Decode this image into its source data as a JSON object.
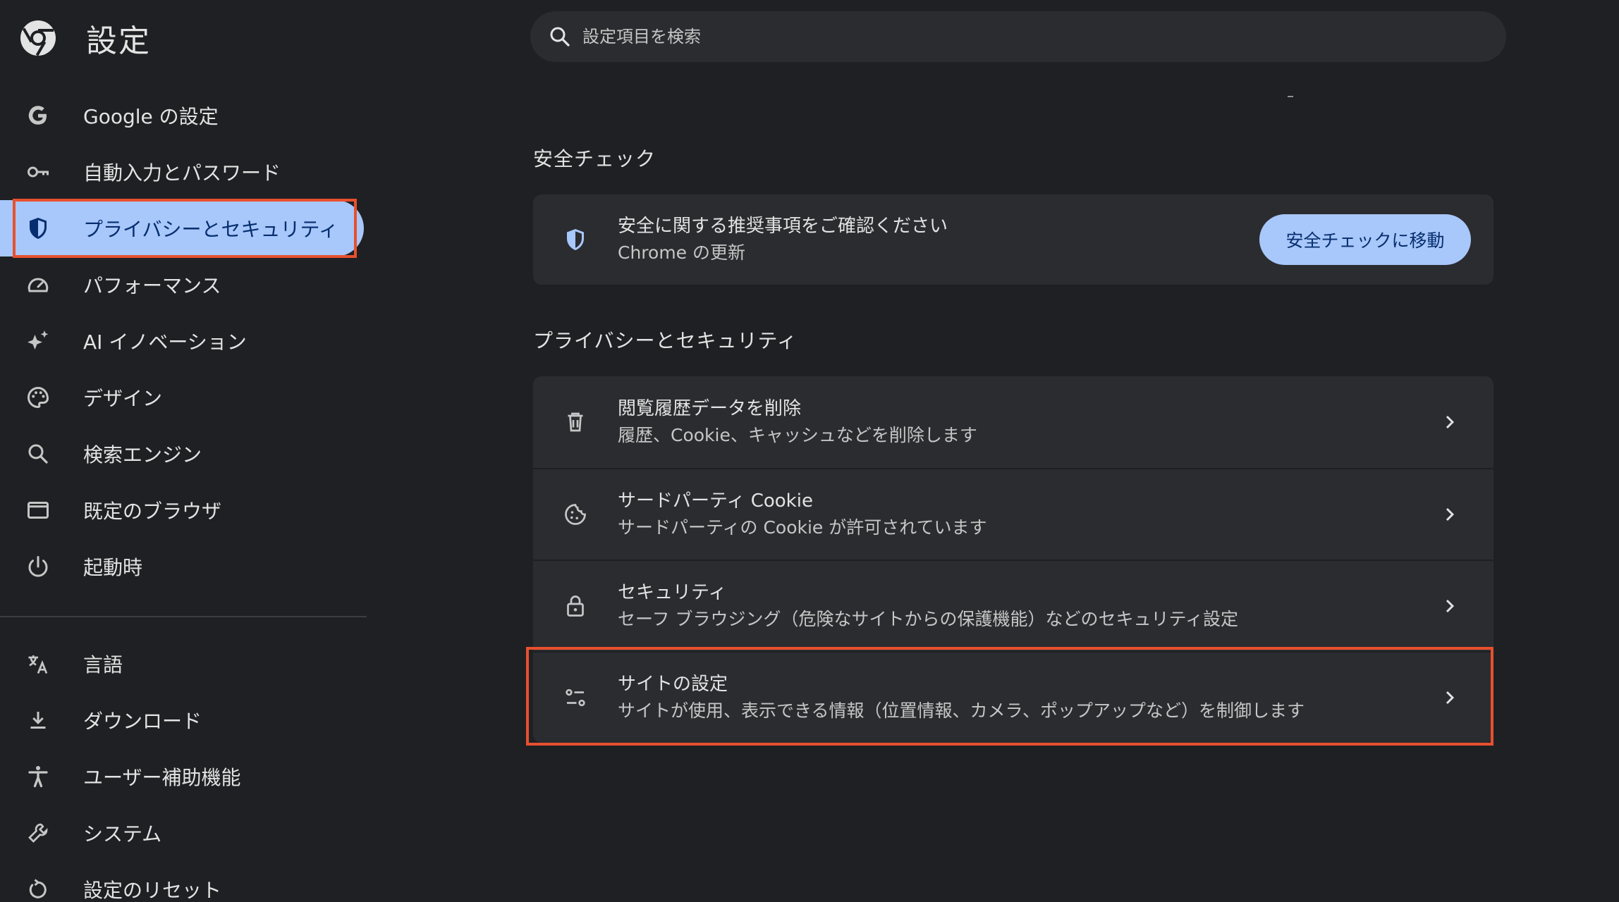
{
  "header": {
    "title": "設定",
    "logo_icon": "chrome-logo-icon"
  },
  "search": {
    "placeholder": "設定項目を検索",
    "icon": "search-icon"
  },
  "sidebar": {
    "active_color": "#a8c7fa",
    "items": [
      {
        "label": "Google の設定",
        "icon": "google-g-icon"
      },
      {
        "label": "自動入力とパスワード",
        "icon": "key-icon"
      },
      {
        "label": "プライバシーとセキュリティ",
        "icon": "shield-icon",
        "active": true
      },
      {
        "label": "パフォーマンス",
        "icon": "speedometer-icon"
      },
      {
        "label": "AI イノベーション",
        "icon": "sparkle-icon"
      },
      {
        "label": "デザイン",
        "icon": "palette-icon"
      },
      {
        "label": "検索エンジン",
        "icon": "search-icon"
      },
      {
        "label": "既定のブラウザ",
        "icon": "browser-window-icon"
      },
      {
        "label": "起動時",
        "icon": "power-icon"
      }
    ],
    "items2": [
      {
        "label": "言語",
        "icon": "translate-icon"
      },
      {
        "label": "ダウンロード",
        "icon": "download-icon"
      },
      {
        "label": "ユーザー補助機能",
        "icon": "accessibility-icon"
      },
      {
        "label": "システム",
        "icon": "wrench-icon"
      },
      {
        "label": "設定のリセット",
        "icon": "reset-icon"
      }
    ]
  },
  "safety": {
    "section_title": "安全チェック",
    "title": "安全に関する推奨事項をご確認ください",
    "subtitle": "Chrome の更新",
    "button": "安全チェックに移動",
    "icon": "shield-check-icon"
  },
  "privacy": {
    "section_title": "プライバシーとセキュリティ",
    "rows": [
      {
        "title": "閲覧履歴データを削除",
        "subtitle": "履歴、Cookie、キャッシュなどを削除します",
        "icon": "trash-icon"
      },
      {
        "title": "サードパーティ Cookie",
        "subtitle": "サードパーティの Cookie が許可されています",
        "icon": "cookie-icon"
      },
      {
        "title": "セキュリティ",
        "subtitle": "セーフ ブラウジング（危険なサイトからの保護機能）などのセキュリティ設定",
        "icon": "lock-icon"
      },
      {
        "title": "サイトの設定",
        "subtitle": "サイトが使用、表示できる情報（位置情報、カメラ、ポップアップなど）を制御します",
        "icon": "tune-icon"
      }
    ]
  },
  "annotation_color": "#e8502e"
}
